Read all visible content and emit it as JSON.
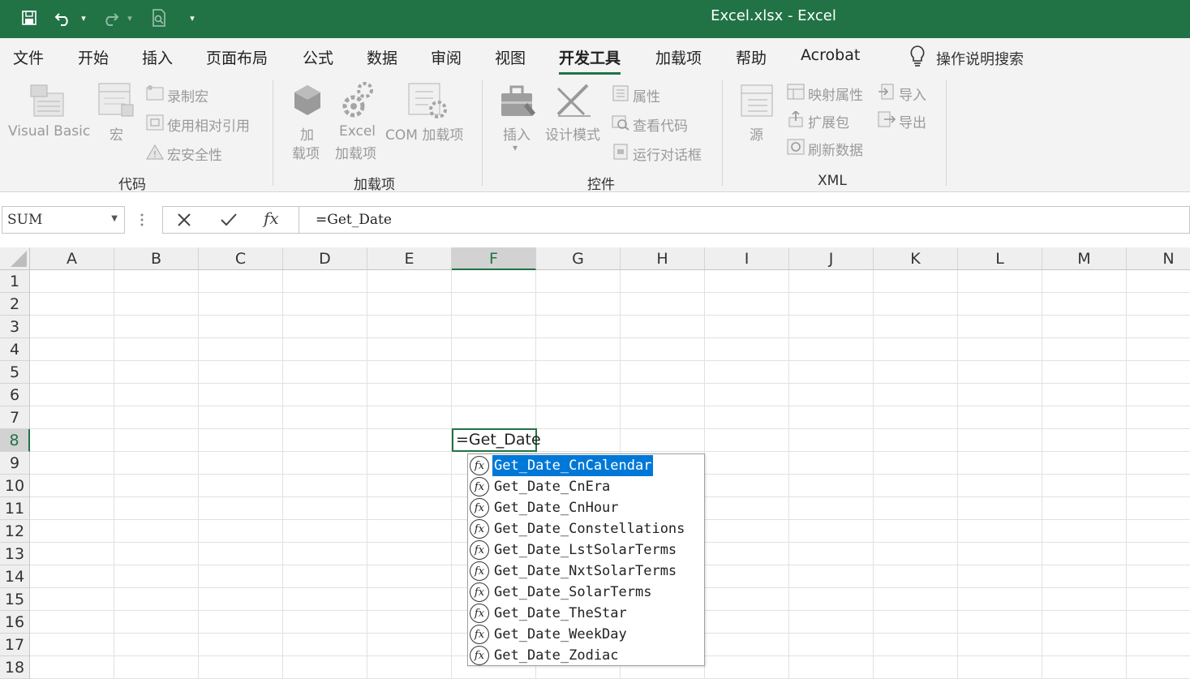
{
  "titlebar": {
    "title": "Excel.xlsx  -  Excel",
    "accent_color": "#217346",
    "quick_access": [
      "save-icon",
      "undo-icon",
      "redo-icon",
      "print-preview-icon",
      "customize-icon"
    ]
  },
  "menu": {
    "tabs": [
      "文件",
      "开始",
      "插入",
      "页面布局",
      "公式",
      "数据",
      "审阅",
      "视图",
      "开发工具",
      "加载项",
      "帮助",
      "Acrobat"
    ],
    "active_tab": "开发工具",
    "tell_me": "操作说明搜索"
  },
  "ribbon": {
    "code": {
      "group_label": "代码",
      "visual_basic": "Visual Basic",
      "macros": "宏",
      "record_macro": "录制宏",
      "relative_ref": "使用相对引用",
      "macro_security": "宏安全性"
    },
    "addins": {
      "group_label": "加载项",
      "addins_line1": "加",
      "addins_line2": "载项",
      "excel_addins_line1": "Excel",
      "excel_addins_line2": "加载项",
      "com_addins": "COM 加载项"
    },
    "controls": {
      "group_label": "控件",
      "insert": "插入",
      "design_mode": "设计模式",
      "properties": "属性",
      "view_code": "查看代码",
      "run_dialog": "运行对话框"
    },
    "xml": {
      "group_label": "XML",
      "source": "源",
      "map_properties": "映射属性",
      "expansion_packs": "扩展包",
      "refresh_data": "刷新数据",
      "import": "导入",
      "export": "导出"
    }
  },
  "formula_bar": {
    "name_box": "SUM",
    "formula": "=Get_Date"
  },
  "grid": {
    "columns": [
      "A",
      "B",
      "C",
      "D",
      "E",
      "F",
      "G",
      "H",
      "I",
      "J",
      "K",
      "L",
      "M",
      "N"
    ],
    "rows": [
      "1",
      "2",
      "3",
      "4",
      "5",
      "6",
      "7",
      "8",
      "9",
      "10",
      "11",
      "12",
      "13",
      "14",
      "15",
      "16",
      "17",
      "18"
    ],
    "active_column": "F",
    "active_row": "8",
    "active_cell_text": "=Get_Date"
  },
  "autocomplete": {
    "items": [
      "Get_Date_CnCalendar",
      "Get_Date_CnEra",
      "Get_Date_CnHour",
      "Get_Date_Constellations",
      "Get_Date_LstSolarTerms",
      "Get_Date_NxtSolarTerms",
      "Get_Date_SolarTerms",
      "Get_Date_TheStar",
      "Get_Date_WeekDay",
      "Get_Date_Zodiac"
    ],
    "selected_index": 0,
    "icon_glyph": "fx"
  }
}
